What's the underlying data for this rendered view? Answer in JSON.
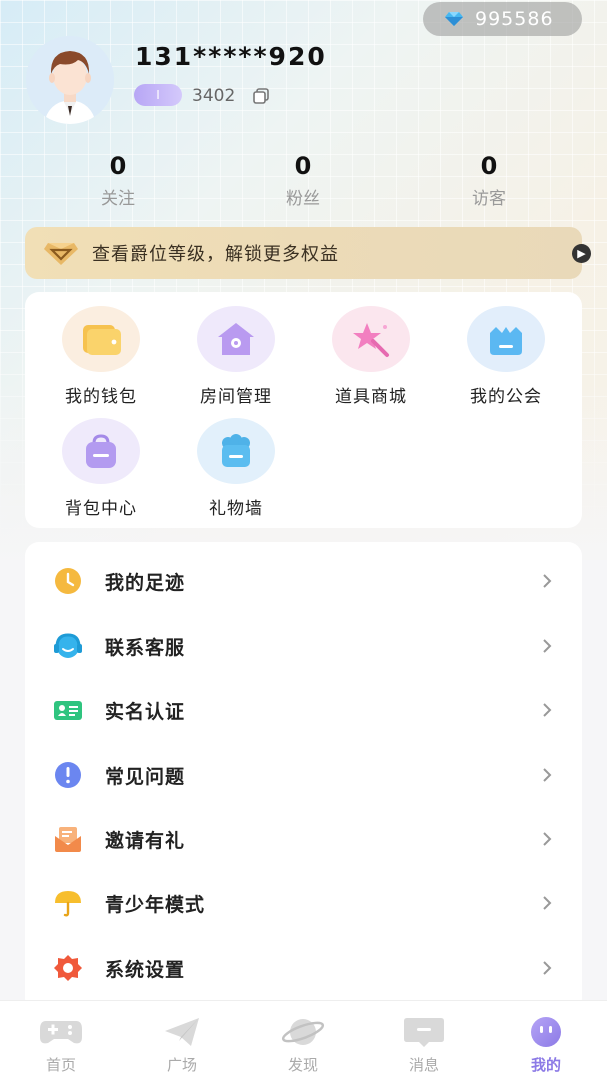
{
  "balance": {
    "icon": "diamond-icon",
    "value": "995586"
  },
  "profile": {
    "avatar": "avatar",
    "username": "131*****920",
    "level_badge": "I",
    "user_id": "3402"
  },
  "stats": [
    {
      "value": "0",
      "label": "关注"
    },
    {
      "value": "0",
      "label": "粉丝"
    },
    {
      "value": "0",
      "label": "访客"
    }
  ],
  "vip_banner": {
    "text": "查看爵位等级，解锁更多权益"
  },
  "grid": [
    {
      "label": "我的钱包",
      "icon": "wallet-icon"
    },
    {
      "label": "房间管理",
      "icon": "room-icon"
    },
    {
      "label": "道具商城",
      "icon": "magic-wand-icon"
    },
    {
      "label": "我的公会",
      "icon": "guild-icon"
    },
    {
      "label": "背包中心",
      "icon": "backpack-icon"
    },
    {
      "label": "礼物墙",
      "icon": "gift-wall-icon"
    }
  ],
  "menu": [
    {
      "label": "我的足迹",
      "icon": "clock-icon"
    },
    {
      "label": "联系客服",
      "icon": "headset-icon"
    },
    {
      "label": "实名认证",
      "icon": "id-card-icon"
    },
    {
      "label": "常见问题",
      "icon": "exclamation-icon"
    },
    {
      "label": "邀请有礼",
      "icon": "envelope-icon"
    },
    {
      "label": "青少年模式",
      "icon": "umbrella-icon"
    },
    {
      "label": "系统设置",
      "icon": "gear-icon"
    }
  ],
  "nav": [
    {
      "label": "首页",
      "icon": "gamepad-icon"
    },
    {
      "label": "广场",
      "icon": "paper-plane-icon"
    },
    {
      "label": "发现",
      "icon": "planet-icon"
    },
    {
      "label": "消息",
      "icon": "message-icon"
    },
    {
      "label": "我的",
      "icon": "mine-icon",
      "active": true
    }
  ],
  "colors": {
    "accent": "#8c7ae6",
    "vip_gold": "#f1dfb6"
  }
}
